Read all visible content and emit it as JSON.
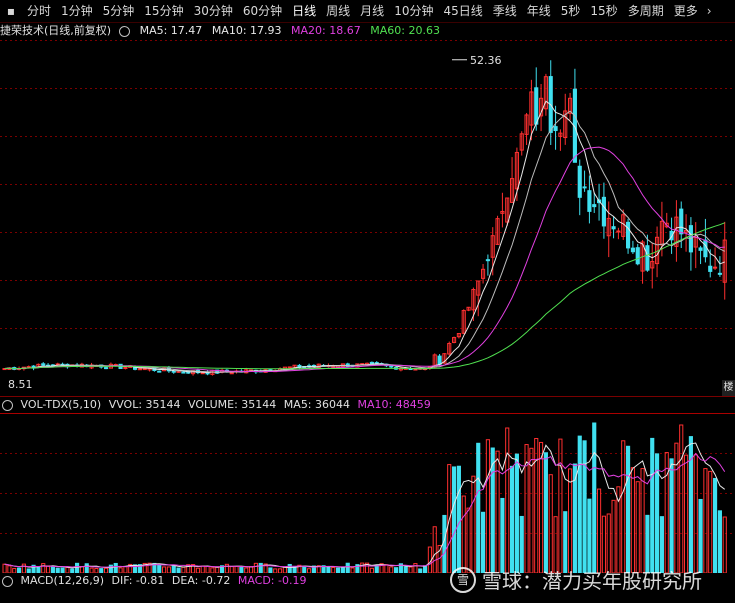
{
  "toolbar": {
    "tabs": [
      "分时",
      "1分钟",
      "5分钟",
      "15分钟",
      "30分钟",
      "60分钟",
      "日线",
      "周线",
      "月线",
      "10分钟",
      "45日线",
      "季线",
      "年线",
      "5秒",
      "15秒",
      "多周期",
      "更多"
    ],
    "active_tab": "日线"
  },
  "info": {
    "stock_name": "捷荣技术(日线,前复权)",
    "ma5": "MA5: 17.47",
    "ma10": "MA10: 17.93",
    "ma20": "MA20: 18.67",
    "ma60": "MA60: 20.63"
  },
  "price": {
    "high_label": "52.36",
    "low_label": "8.51"
  },
  "vol": {
    "name": "VOL-TDX(5,10)",
    "vvol": "VVOL: 35144",
    "volume": "VOLUME: 35144",
    "ma5": "MA5: 36044",
    "ma10": "MA10: 48459"
  },
  "macd": {
    "name": "MACD(12,26,9)",
    "dif": "DIF: -0.81",
    "dea": "DEA: -0.72",
    "macd": "MACD: -0.19"
  },
  "corner_tag": "楼",
  "watermark": {
    "text": "雪球：潜力买年股研究所",
    "logo": "雪"
  },
  "colors": {
    "up": "#ff3030",
    "down": "#40e0f0",
    "grid": "#7a0000",
    "ma5": "#e8e8e8",
    "ma10": "#e8e8e8",
    "ma20": "#e040e0",
    "ma60": "#50e050"
  },
  "chart_data": {
    "type": "candlestick",
    "price_points": {
      "low": 8.51,
      "high": 52.36
    },
    "phases": [
      {
        "name": "consolidation",
        "level": 9.5
      },
      {
        "name": "rally",
        "peak": 52.36
      },
      {
        "name": "pullback_range",
        "low": 22,
        "high": 46
      }
    ]
  }
}
